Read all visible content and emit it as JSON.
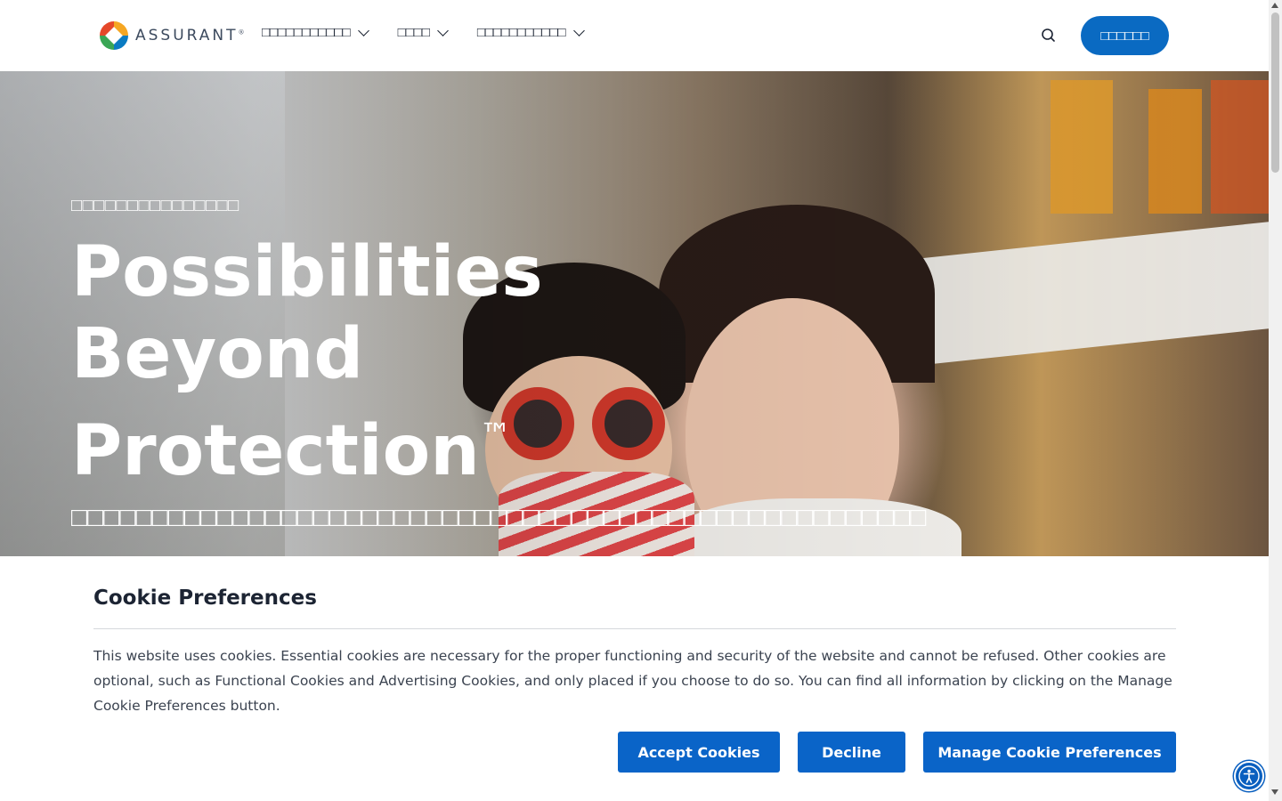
{
  "header": {
    "logo_text": "ASSURANT",
    "logo_reg": "®",
    "nav": [
      {
        "label": "□□□□□□□□□□□"
      },
      {
        "label": "□□□□"
      },
      {
        "label": "□□□□□□□□□□□"
      }
    ],
    "search_icon": "search-icon",
    "contact_label": "□□□□□□"
  },
  "hero": {
    "eyebrow": "□□□□□□□□□□□□□□□",
    "title": "Possibilities Beyond Protection",
    "title_tm": "™",
    "subtitle": "□□□□□□□□□□□□□□□□□□□□□□□□□□□□□□□□□□□□□□□□□□□□□□□□□□□□□"
  },
  "cookie": {
    "title": "Cookie Preferences",
    "body": "This website uses cookies. Essential cookies are necessary for the proper functioning and security of the website and cannot be refused. Other cookies are optional, such as Functional Cookies and Advertising Cookies, and only placed if you choose to do so. You can find all information by clicking on the Manage Cookie Preferences button.",
    "accept_label": "Accept Cookies",
    "decline_label": "Decline",
    "manage_label": "Manage Cookie Preferences"
  },
  "accessibility": {
    "icon": "accessibility-icon"
  },
  "colors": {
    "primary_blue": "#0a64c8",
    "contact_blue": "#0a6ac2",
    "text_dark": "#1c2433"
  }
}
